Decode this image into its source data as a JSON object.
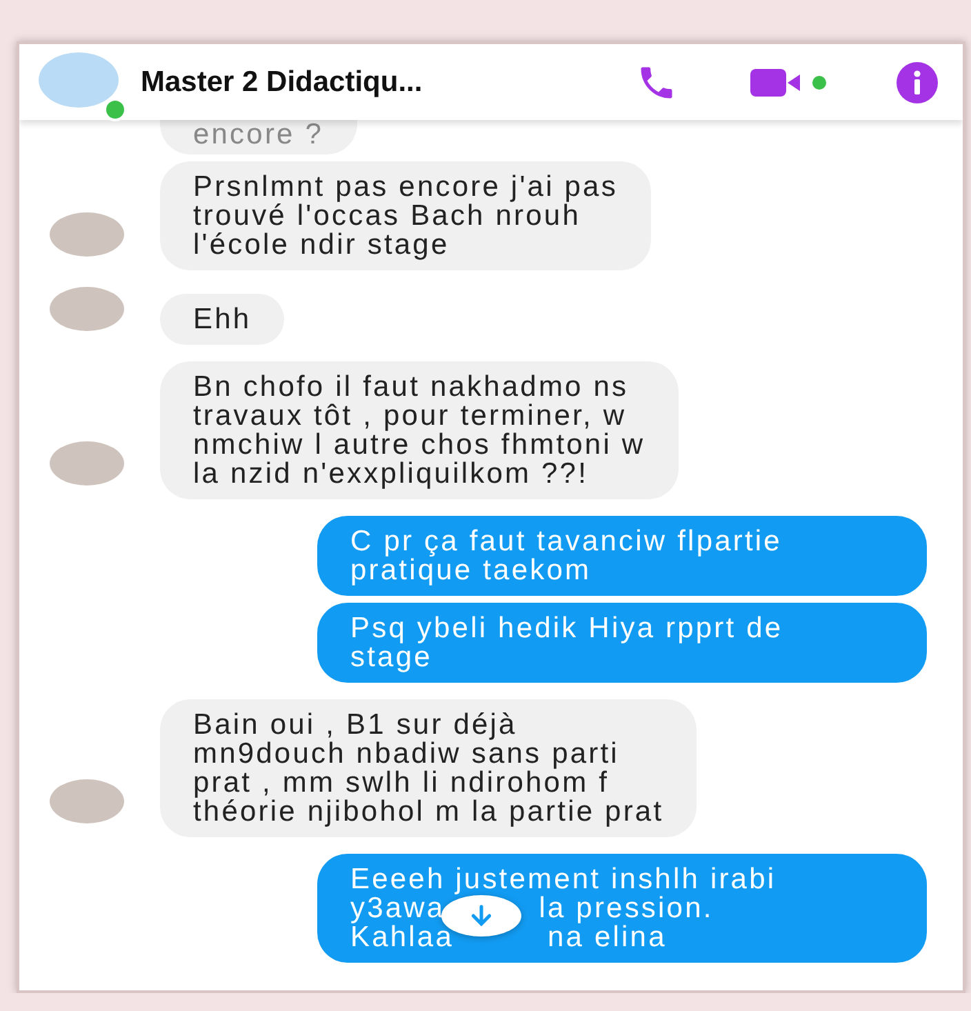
{
  "header": {
    "title": "Master 2 Didactiqu...",
    "online": true,
    "video_online": true
  },
  "groups": [
    {
      "kind": "received",
      "messages": [
        {
          "kind": "partial",
          "lines": [
            [
              "encore ?"
            ]
          ]
        },
        {
          "kind": "full",
          "lines": [
            [
              "Prsnlmnt pas encore j'ai pas"
            ],
            [
              "trouvé l'occas Bach nrouh"
            ],
            [
              "l'école ndir stage"
            ]
          ]
        }
      ]
    },
    {
      "kind": "received",
      "messages": [
        {
          "kind": "full",
          "lines": [
            [
              "Ehh"
            ]
          ]
        }
      ]
    },
    {
      "kind": "received",
      "messages": [
        {
          "kind": "full",
          "lines": [
            [
              "Bn chofo il faut nakhadmo ns"
            ],
            [
              "travaux tôt , pour terminer, w"
            ],
            [
              "nmchiw l autre chos fhmtoni w"
            ],
            [
              "la nzid n'exxpliquilkom ??!"
            ]
          ]
        }
      ]
    },
    {
      "kind": "sent",
      "messages": [
        {
          "kind": "full",
          "lines": [
            [
              "C pr ça faut tavanciw flpartie"
            ],
            [
              "pratique taekom"
            ]
          ]
        },
        {
          "kind": "full",
          "lines": [
            [
              "Psq ybeli hedik Hiya rpprt de"
            ],
            [
              "stage"
            ]
          ]
        }
      ]
    },
    {
      "kind": "received",
      "messages": [
        {
          "kind": "full",
          "lines": [
            [
              "Bain oui , B1 sur déjà"
            ],
            [
              "mn9douch nbadiw sans parti"
            ],
            [
              "prat , mm swlh li ndirohom f"
            ],
            [
              "théorie njibohol m la partie prat"
            ]
          ]
        }
      ]
    },
    {
      "kind": "sent",
      "messages": [
        {
          "kind": "full",
          "lines": [
            [
              "Eeeeh justement inshlh irabi"
            ],
            [
              "y3awa",
              "la pression."
            ],
            [
              "Kahlaa",
              "na elina"
            ]
          ]
        }
      ]
    }
  ]
}
